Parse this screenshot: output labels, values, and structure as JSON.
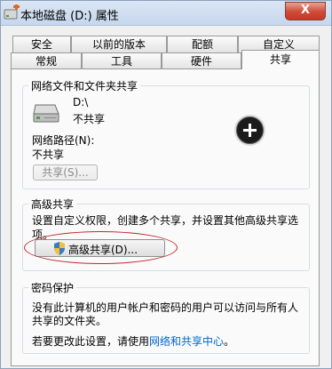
{
  "window": {
    "title": "本地磁盘 (D:) 属性",
    "close_glyph": "X"
  },
  "tabs": {
    "row_back": [
      "安全",
      "以前的版本",
      "配额",
      "自定义"
    ],
    "row_front": [
      "常规",
      "工具",
      "硬件",
      "共享"
    ],
    "active": "共享"
  },
  "network_sharing": {
    "title": "网络文件和文件夹共享",
    "drive_label": "D:\\",
    "drive_status": "不共享",
    "path_label": "网络路径(N):",
    "path_value": "不共享",
    "share_button": "共享(S)..."
  },
  "advanced_sharing": {
    "title": "高级共享",
    "description_line1": "设置自定义权限，创建多个共享，并设置其他高级共享选",
    "description_line2": "项。",
    "button": "高级共享(D)..."
  },
  "password_protection": {
    "title": "密码保护",
    "description_line1": "没有此计算机的用户帐户和密码的用户可以访问与所有人",
    "description_line2": "共享的文件夹。",
    "change_prefix": "若要更改此设置，请使用",
    "change_link": "网络和共享中心",
    "change_suffix": "。"
  },
  "icons": {
    "app": "drive-properties-icon",
    "drive": "hard-drive-icon",
    "overlay": "add-circle-icon",
    "shield": "uac-shield-icon"
  }
}
